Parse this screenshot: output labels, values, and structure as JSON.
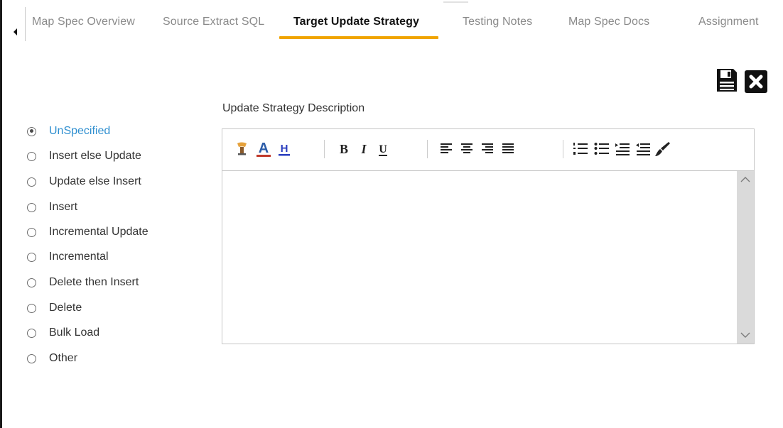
{
  "tabs": [
    {
      "label": "Map Spec Overview",
      "active": false
    },
    {
      "label": "Source Extract SQL",
      "active": false
    },
    {
      "label": "Target Update Strategy",
      "active": true
    },
    {
      "label": "Testing Notes",
      "active": false
    },
    {
      "label": "Map Spec Docs",
      "active": false
    },
    {
      "label": "Assignment",
      "active": false
    }
  ],
  "actions": {
    "save_icon": "floppy-disk-icon",
    "close_icon": "close-x-icon"
  },
  "description_label": "Update Strategy Description",
  "strategy_options": [
    {
      "label": "UnSpecified",
      "selected": true
    },
    {
      "label": "Insert else Update",
      "selected": false
    },
    {
      "label": "Update else Insert",
      "selected": false
    },
    {
      "label": "Insert",
      "selected": false
    },
    {
      "label": "Incremental Update",
      "selected": false
    },
    {
      "label": "Incremental",
      "selected": false
    },
    {
      "label": "Delete then Insert",
      "selected": false
    },
    {
      "label": "Delete",
      "selected": false
    },
    {
      "label": "Bulk Load",
      "selected": false
    },
    {
      "label": "Other",
      "selected": false
    }
  ],
  "editor": {
    "content": "",
    "toolbar": {
      "font_color_glyph": "A",
      "highlight_glyph": "H",
      "bold_glyph": "B",
      "italic_glyph": "I",
      "underline_glyph": "U"
    }
  },
  "colors": {
    "tab_accent": "#f0a400",
    "selected_option": "#2f8fd0",
    "font_color_bar": "#c0392b",
    "highlight_blue": "#2b3fbf"
  }
}
